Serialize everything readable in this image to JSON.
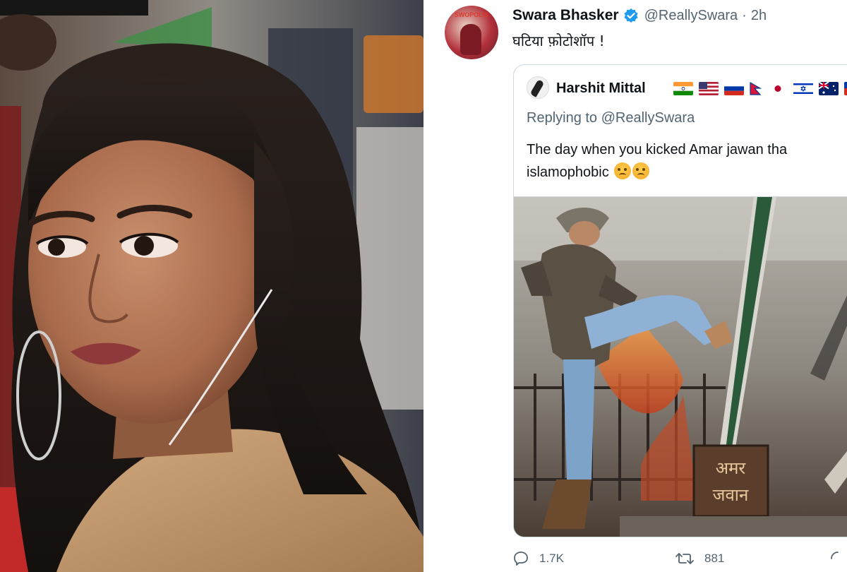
{
  "tweet": {
    "author_name": "Swara Bhasker",
    "handle": "@ReallySwara",
    "separator": "·",
    "time": "2h",
    "text": "घटिया फ़ोटोशॉप !",
    "avatar_caption": "SWOPOLIS",
    "verified": true,
    "colors": {
      "accent": "#1d9bf0",
      "text": "#0f1419",
      "muted": "#536471",
      "border": "#cfd9de"
    }
  },
  "quoted_tweet": {
    "author_name": "Harshit Mittal",
    "flags": [
      "india-flag",
      "usa-flag",
      "russia-flag",
      "nepal-flag",
      "japan-flag",
      "israel-flag",
      "australia-flag",
      "extra-flag"
    ],
    "replying_label": "Replying to",
    "replying_handle": "@ReallySwara",
    "text_line1": "The day when you kicked Amar jawan tha",
    "text_line2": "islamophobic",
    "emojis": [
      "angry-face-icon",
      "angry-face-icon"
    ],
    "image_sign_line1": "अमर",
    "image_sign_line2": "जवान"
  },
  "actions": {
    "replies": "1.7K",
    "retweets": "881"
  }
}
